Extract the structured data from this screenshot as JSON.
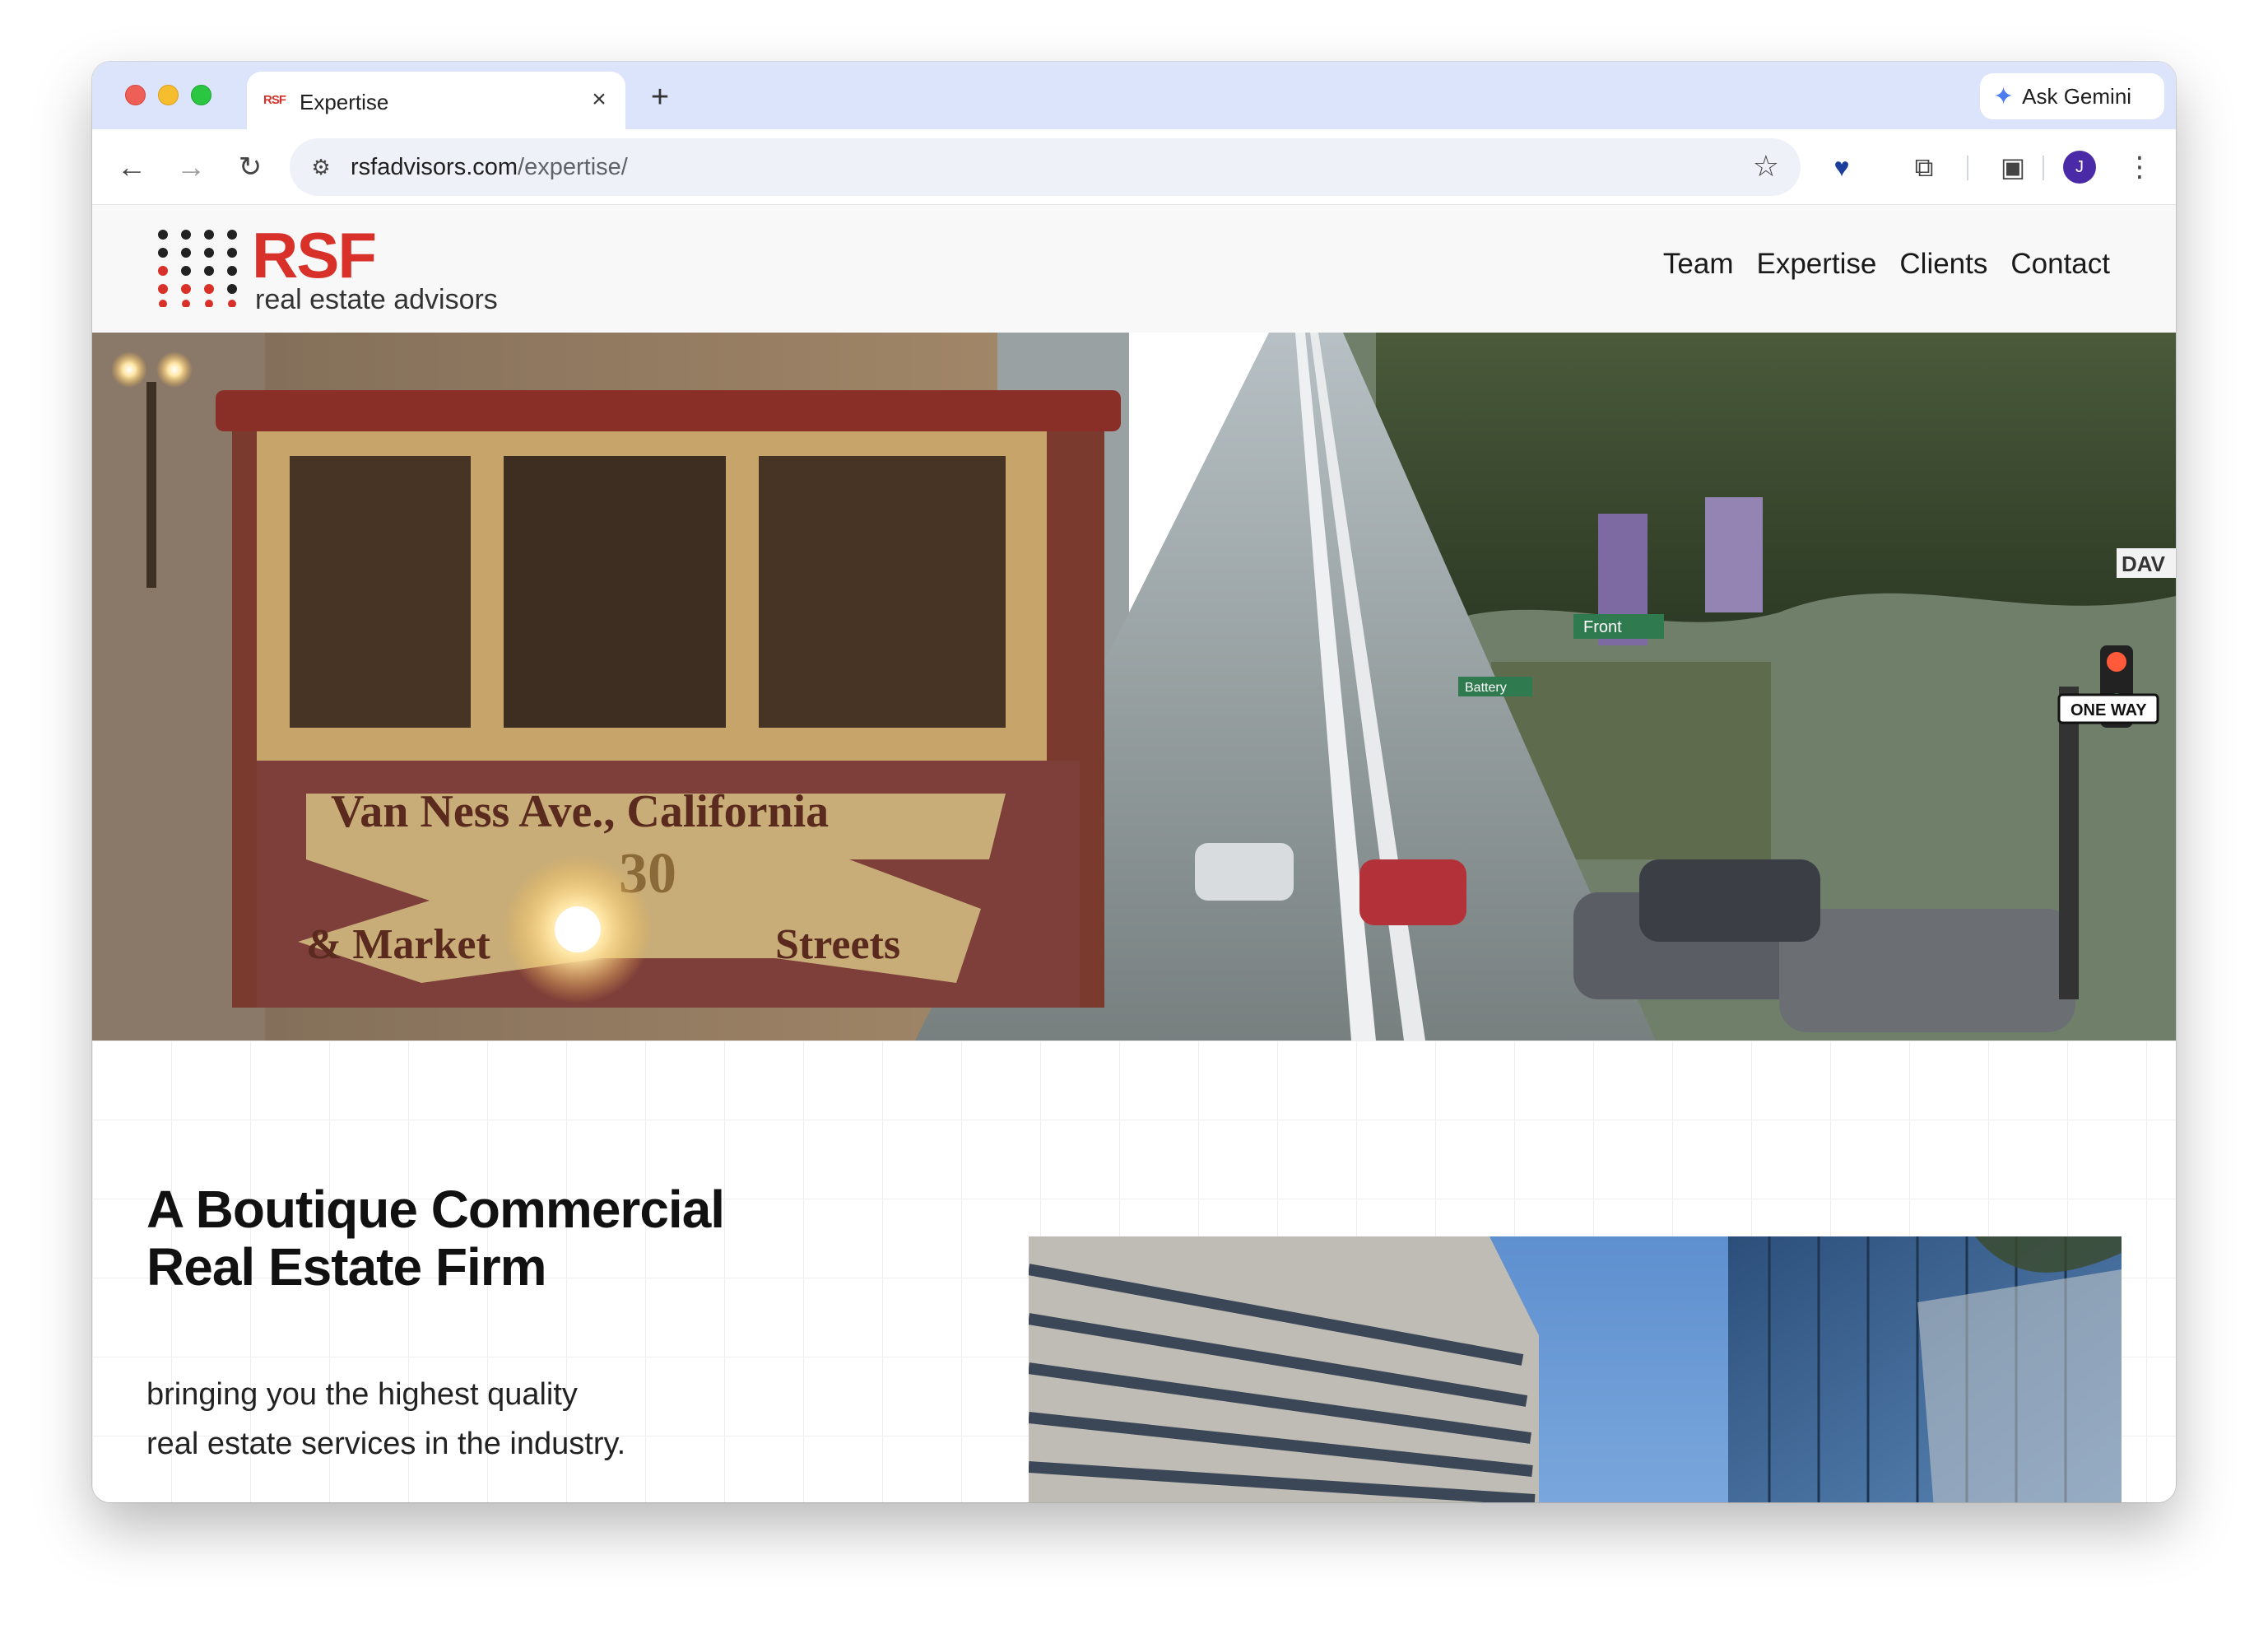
{
  "browser": {
    "tab": {
      "title": "Expertise",
      "favicon_text": "RSF"
    },
    "ask_gemini_label": "Ask Gemini",
    "url": {
      "domain": "rsfadvisors.com",
      "path": "/expertise/"
    },
    "profile_initial": "J"
  },
  "site": {
    "logo": {
      "name": "RSF",
      "tagline": "real estate advisors",
      "brand_color": "#d8312a"
    },
    "nav": [
      "Team",
      "Expertise",
      "Clients",
      "Contact"
    ],
    "hero": {
      "cable_car_sign": {
        "line1": "Van Ness Ave., California",
        "number": "30",
        "left": "& Market",
        "right": "Streets"
      },
      "street_signs": [
        "ONE WAY",
        "Front",
        "Battery",
        "DAV"
      ]
    },
    "intro": {
      "headline_line1": "A Boutique Commercial",
      "headline_line2": "Real Estate Firm",
      "tagline_line1": "bringing you the highest quality",
      "tagline_line2": "real estate services in the industry."
    }
  }
}
